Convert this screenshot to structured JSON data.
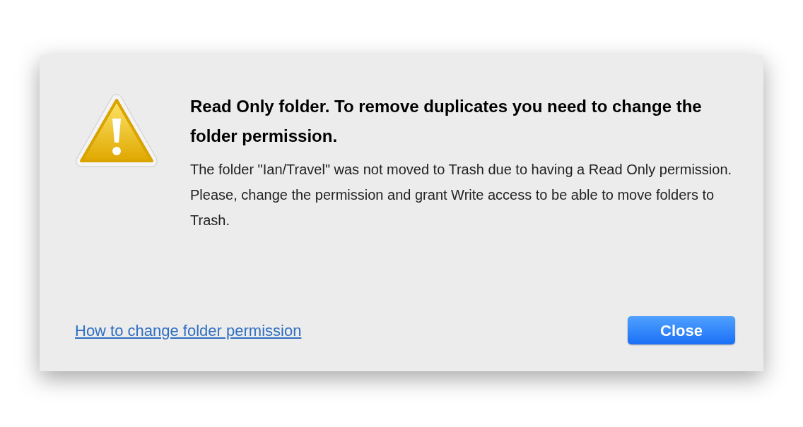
{
  "dialog": {
    "title": "Read Only folder. To remove duplicates you need to change the folder permission.",
    "message": [
      "The folder \"Ian/Travel\" was not moved to Trash due to having a Read Only permission.",
      "Please, change the permission and grant Write access to be able to move folders to Trash."
    ],
    "link": "How to change folder permission",
    "buttons": [
      "Close"
    ]
  }
}
